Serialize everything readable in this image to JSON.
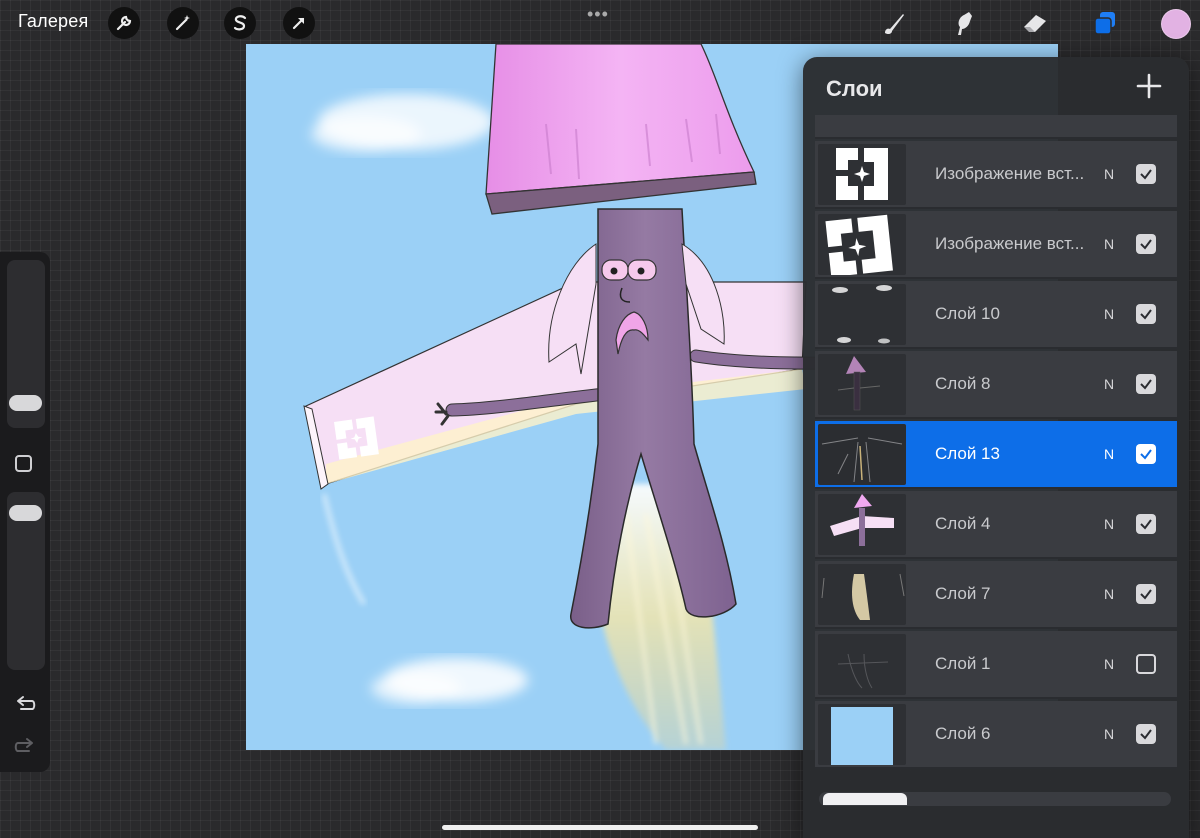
{
  "topbar": {
    "gallery_label": "Галерея",
    "left_tools": [
      "wrench-icon",
      "magic-wand-icon",
      "selection-s-icon",
      "move-arrow-icon"
    ],
    "right_tools": [
      "brush-icon",
      "smudge-icon",
      "eraser-icon",
      "layers-icon"
    ],
    "current_color": "#e2b2e3",
    "more_dots": "•••"
  },
  "sidebar": {
    "tools": [
      "brush-size-slider",
      "modifier-button",
      "opacity-slider",
      "undo-icon",
      "redo-icon"
    ]
  },
  "layers_panel": {
    "title": "Слои",
    "add_icon": "plus-icon",
    "layers": [
      {
        "name": "Изображение вст...",
        "blend": "N",
        "visible": true,
        "selected": false,
        "thumb": "logo-small"
      },
      {
        "name": "Изображение вст...",
        "blend": "N",
        "visible": true,
        "selected": false,
        "thumb": "logo-large"
      },
      {
        "name": "Слой 10",
        "blend": "N",
        "visible": true,
        "selected": false,
        "thumb": "clouds"
      },
      {
        "name": "Слой 8",
        "blend": "N",
        "visible": true,
        "selected": false,
        "thumb": "figure-dark"
      },
      {
        "name": "Слой 13",
        "blend": "N",
        "visible": true,
        "selected": true,
        "thumb": "lines"
      },
      {
        "name": "Слой 4",
        "blend": "N",
        "visible": true,
        "selected": false,
        "thumb": "character"
      },
      {
        "name": "Слой 7",
        "blend": "N",
        "visible": true,
        "selected": false,
        "thumb": "flame"
      },
      {
        "name": "Слой 1",
        "blend": "N",
        "visible": false,
        "selected": false,
        "thumb": "sketch"
      },
      {
        "name": "Слой 6",
        "blend": "N",
        "visible": true,
        "selected": false,
        "thumb": "sky"
      }
    ]
  },
  "colors": {
    "accent": "#0d6ee8",
    "sky": "#9bd0f6",
    "hat": "#f0a8f0",
    "body": "#8c6f9a"
  }
}
